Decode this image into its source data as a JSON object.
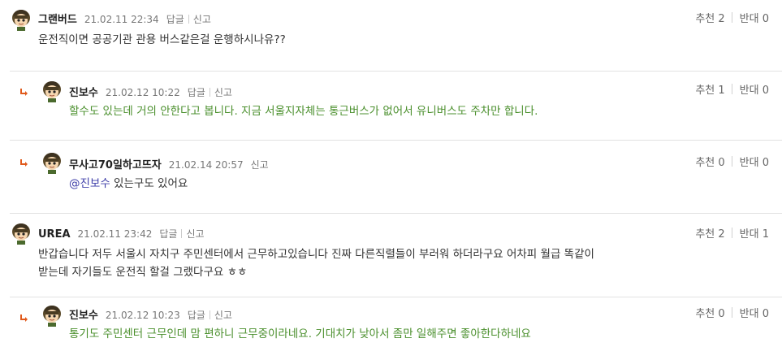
{
  "comments": [
    {
      "nickname": "그랜버드",
      "datetime": "21.02.11 22:34",
      "reply_label": "답글",
      "report_label": "신고",
      "upvote_label": "추천 2",
      "downvote_label": "반대 0",
      "body": "운전직이면 공공기관 관용 버스같은걸 운행하시나유??"
    },
    {
      "nickname": "진보수",
      "datetime": "21.02.12 10:22",
      "reply_label": "답글",
      "report_label": "신고",
      "upvote_label": "추천 1",
      "downvote_label": "반대 0",
      "body": "할수도 있는데 거의 안한다고 봅니다. 지금 서울지자체는 통근버스가 없어서 유니버스도 주차만 합니다."
    },
    {
      "nickname": "무사고70일하고뜨자",
      "datetime": "21.02.14 20:57",
      "report_label": "신고",
      "upvote_label": "추천 0",
      "downvote_label": "반대 0",
      "mention": "@진보수",
      "body": " 있는구도 있어요"
    },
    {
      "nickname": "UREA",
      "datetime": "21.02.11 23:42",
      "reply_label": "답글",
      "report_label": "신고",
      "upvote_label": "추천 2",
      "downvote_label": "반대 1",
      "body_line1": "반갑습니다 저두 서울시 자치구 주민센터에서 근무하고있습니다 진짜 다른직렬들이 부러워 하더라구요 어차피 월급 똑같이",
      "body_line2": "받는데 자기들도 운전직 할걸 그랬다구요 ㅎㅎ"
    },
    {
      "nickname": "진보수",
      "datetime": "21.02.12 10:23",
      "reply_label": "답글",
      "report_label": "신고",
      "upvote_label": "추천 0",
      "downvote_label": "반대 0",
      "body": "통기도 주민센터 근무인데 맘 편하니 근무중이라네요. 기대치가 낮아서 좀만 일해주면 좋아한다하네요"
    }
  ],
  "colors": {
    "reply_arrow": "#e05a1c",
    "reply_text": "#4a8f2c",
    "mention": "#3c3ca8",
    "divider": "#e2e2e2"
  },
  "icons": {
    "avatar": "maplestory-character-avatar-icon",
    "reply_arrow": "reply-arrow-icon"
  }
}
